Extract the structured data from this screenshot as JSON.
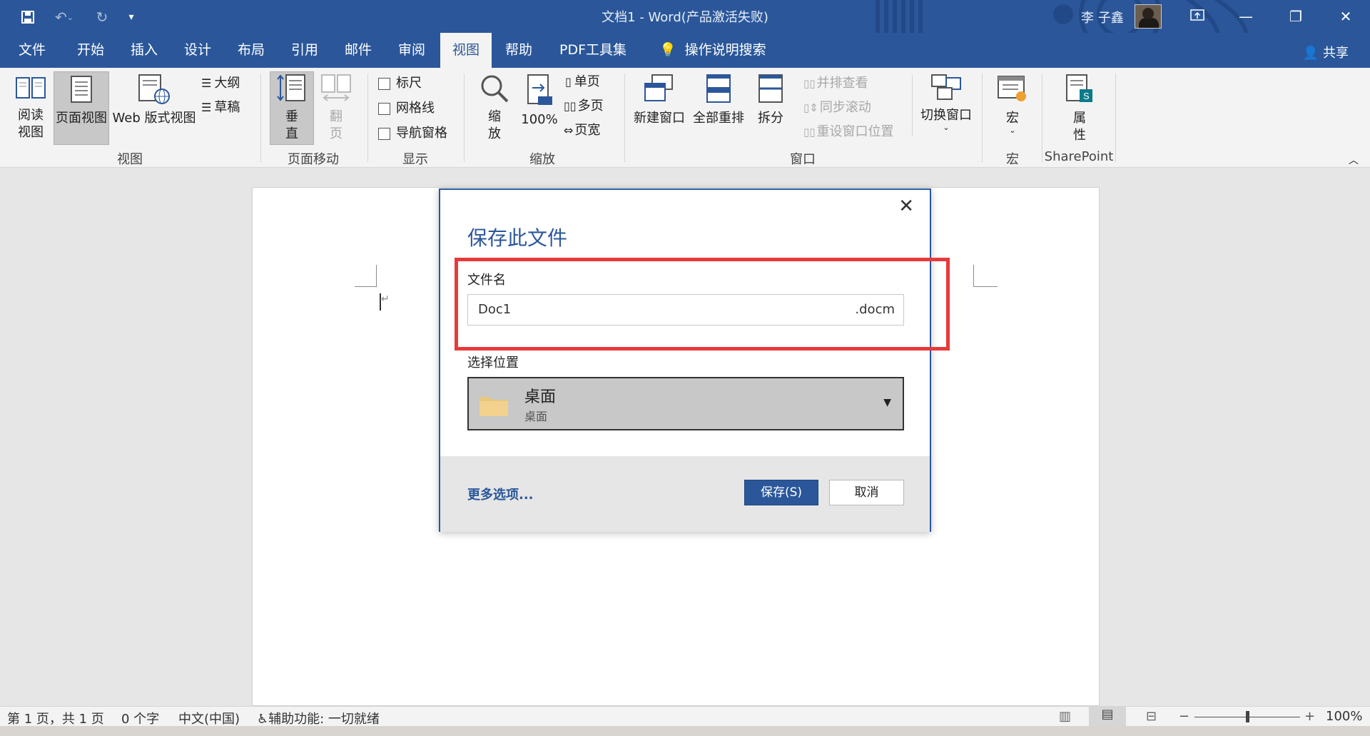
{
  "window": {
    "title": "文档1  -  Word(产品激活失败)",
    "user_name": "李 子鑫"
  },
  "menu_tabs": [
    {
      "label": "文件"
    },
    {
      "label": "开始"
    },
    {
      "label": "插入"
    },
    {
      "label": "设计"
    },
    {
      "label": "布局"
    },
    {
      "label": "引用"
    },
    {
      "label": "邮件"
    },
    {
      "label": "审阅"
    },
    {
      "label": "视图",
      "active": true
    },
    {
      "label": "帮助"
    },
    {
      "label": "PDF工具集"
    },
    {
      "label": "操作说明搜索"
    }
  ],
  "share_label": "共享",
  "ribbon": {
    "views": {
      "group_label": "视图",
      "read_mode": "阅读\n视图",
      "read_mode_line1": "阅读",
      "read_mode_line2": "视图",
      "print_layout": "页面视图",
      "web_layout": "Web 版式视图",
      "outline": "大纲",
      "draft": "草稿"
    },
    "page_movement": {
      "group_label": "页面移动",
      "vertical_line1": "垂",
      "vertical_line2": "直",
      "side_to_side_line1": "翻",
      "side_to_side_line2": "页"
    },
    "show": {
      "group_label": "显示",
      "ruler": "标尺",
      "gridlines": "网格线",
      "nav_pane": "导航窗格"
    },
    "zoom": {
      "group_label": "缩放",
      "zoom_line1": "缩",
      "zoom_line2": "放",
      "hundred": "100%",
      "one_page": "单页",
      "multiple_pages": "多页",
      "page_width": "页宽"
    },
    "window": {
      "group_label": "窗口",
      "new_window": "新建窗口",
      "arrange_all": "全部重排",
      "split": "拆分",
      "view_side_by_side": "并排查看",
      "sync_scrolling": "同步滚动",
      "reset_position": "重设窗口位置",
      "switch_windows": "切换窗口"
    },
    "macros": {
      "group_label": "宏",
      "macro": "宏"
    },
    "sharepoint": {
      "group_label": "SharePoint",
      "properties_line1": "属",
      "properties_line2": "性"
    }
  },
  "dialog": {
    "title": "保存此文件",
    "filename_label": "文件名",
    "filename_value": "Doc1",
    "extension": ".docm",
    "location_label": "选择位置",
    "location_main": "桌面",
    "location_sub": "桌面",
    "more_options": "更多选项...",
    "save_button": "保存(S)",
    "cancel_button": "取消"
  },
  "status_bar": {
    "page_info": "第 1 页，共 1 页",
    "word_count": "0 个字",
    "language": "中文(中国)",
    "accessibility": "辅助功能: 一切就绪",
    "zoom_percent": "100%",
    "zoom_level": 0.5
  },
  "colors": {
    "accent": "#2b579a",
    "highlight_box": "#e8393a",
    "ribbon_bg": "#f3f3f3"
  }
}
